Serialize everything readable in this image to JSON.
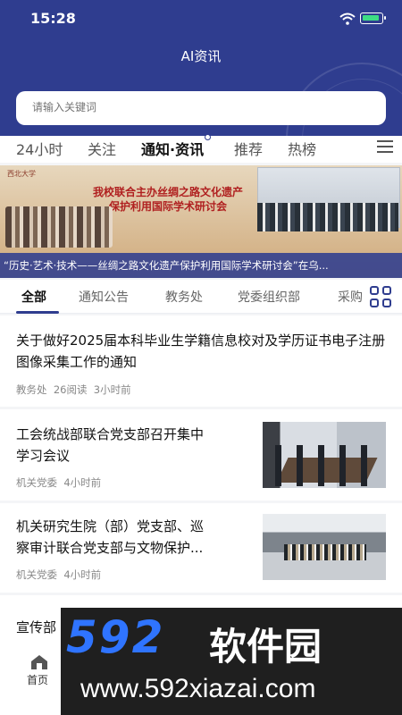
{
  "status_bar": {
    "time": "15:28"
  },
  "header": {
    "title": "AI资讯"
  },
  "search": {
    "placeholder": "请输入关键词"
  },
  "tabs": [
    "24小时",
    "关注",
    "通知·资讯",
    "推荐",
    "热榜"
  ],
  "active_tab": "通知·资讯",
  "banner": {
    "school_name": "西北大学",
    "headline_line1": "我校联合主办丝绸之路文化遗产",
    "headline_line2": "保护利用国际学术研讨会",
    "caption": "“历史·艺术·技术——丝绸之路文化遗产保护利用国际学术研讨会”在乌..."
  },
  "subtabs": [
    "全部",
    "通知公告",
    "教务处",
    "党委组织部",
    "采购"
  ],
  "news": [
    {
      "title": "关于做好2025届本科毕业生学籍信息校对及学历证书电子注册图像采集工作的通知",
      "source": "教务处",
      "reads": "26阅读",
      "time": "3小时前"
    },
    {
      "title_line1": "工会统战部联合党支部召开集中",
      "title_line2": "学习会议",
      "source": "机关党委",
      "time": "4小时前"
    },
    {
      "title_line1": "机关研究生院（部）党支部、巡",
      "title_line2": "察审计联合党支部与文物保护...",
      "source": "机关党委",
      "time": "4小时前"
    },
    {
      "title": "宣传部"
    }
  ],
  "bottom_nav": {
    "home_label": "首页"
  },
  "watermark": {
    "number": "592",
    "name": "软件园",
    "url": "www.592xiazai.com"
  },
  "colors": {
    "primary": "#2f3d8f",
    "accent_blue": "#2f74ff"
  }
}
